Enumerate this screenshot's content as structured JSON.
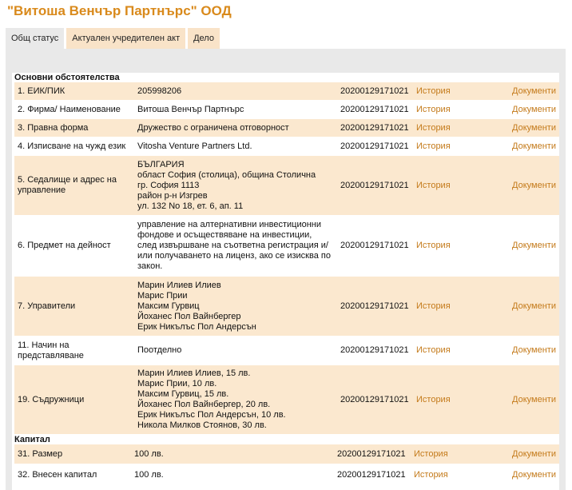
{
  "title": "\"Витоша Венчър Партнърс\" ООД",
  "tabs": [
    {
      "label": "Общ статус"
    },
    {
      "label": "Актуален учредителен акт"
    },
    {
      "label": "Дело"
    }
  ],
  "sections": {
    "main_title": "Основни обстоятелства",
    "capital_title": "Капитал"
  },
  "link_history": "История",
  "link_documents": "Документи",
  "rows": [
    {
      "label": "1.  ЕИК/ПИК",
      "value": [
        "205998206"
      ],
      "date": "20200129171021"
    },
    {
      "label": "2.  Фирма/ Наименование",
      "value": [
        "Витоша Венчър Партнърс"
      ],
      "date": "20200129171021"
    },
    {
      "label": "3.  Правна форма",
      "value": [
        "Дружество с ограничена отговорност"
      ],
      "date": "20200129171021"
    },
    {
      "label": "4.  Изписване на чужд език",
      "value": [
        "Vitosha Venture Partners Ltd."
      ],
      "date": "20200129171021"
    },
    {
      "label": "5.  Седалище и адрес на управление",
      "value": [
        "БЪЛГАРИЯ",
        "област София (столица), община Столична",
        "гр. София 1113",
        "район р-н Изгрев",
        "ул. 132 No 18, ет. 6, ап. 11"
      ],
      "date": "20200129171021"
    },
    {
      "label": "6.  Предмет на дейност",
      "value": [
        "управление на алтернативни инвестиционни",
        "фондове и осъществяване на инвестиции,",
        "след извършване на съответна регистрация и/",
        "или получаването на лиценз, ако се изисква по",
        "закон."
      ],
      "date": "20200129171021"
    },
    {
      "label": "7.  Управители",
      "value": [
        "Марин Илиев Илиев",
        "Марис Прии",
        "Максим Гурвиц",
        "Йоханес Пол Вайнбергер",
        "Ерик Никълъс Пол Андерсън"
      ],
      "date": "20200129171021"
    },
    {
      "label": "11.  Начин на представляване",
      "value": [
        "Поотделно"
      ],
      "date": "20200129171021"
    },
    {
      "label": "19.  Съдружници",
      "value": [
        "Марин Илиев Илиев, 15 лв.",
        "Марис Прии, 10 лв.",
        "Максим Гурвиц, 15 лв.",
        "Йоханес Пол Вайнбергер, 20 лв.",
        "Ерик Никълъс Пол Андерсън, 10 лв.",
        "Никола Милков Стоянов, 30 лв."
      ],
      "date": "20200129171021"
    }
  ],
  "capital_rows": [
    {
      "label": "31.  Размер",
      "value": [
        "100 лв."
      ],
      "date": "20200129171021"
    },
    {
      "label": "32.  Внесен капитал",
      "value": [
        "100 лв."
      ],
      "date": "20200129171021"
    }
  ]
}
